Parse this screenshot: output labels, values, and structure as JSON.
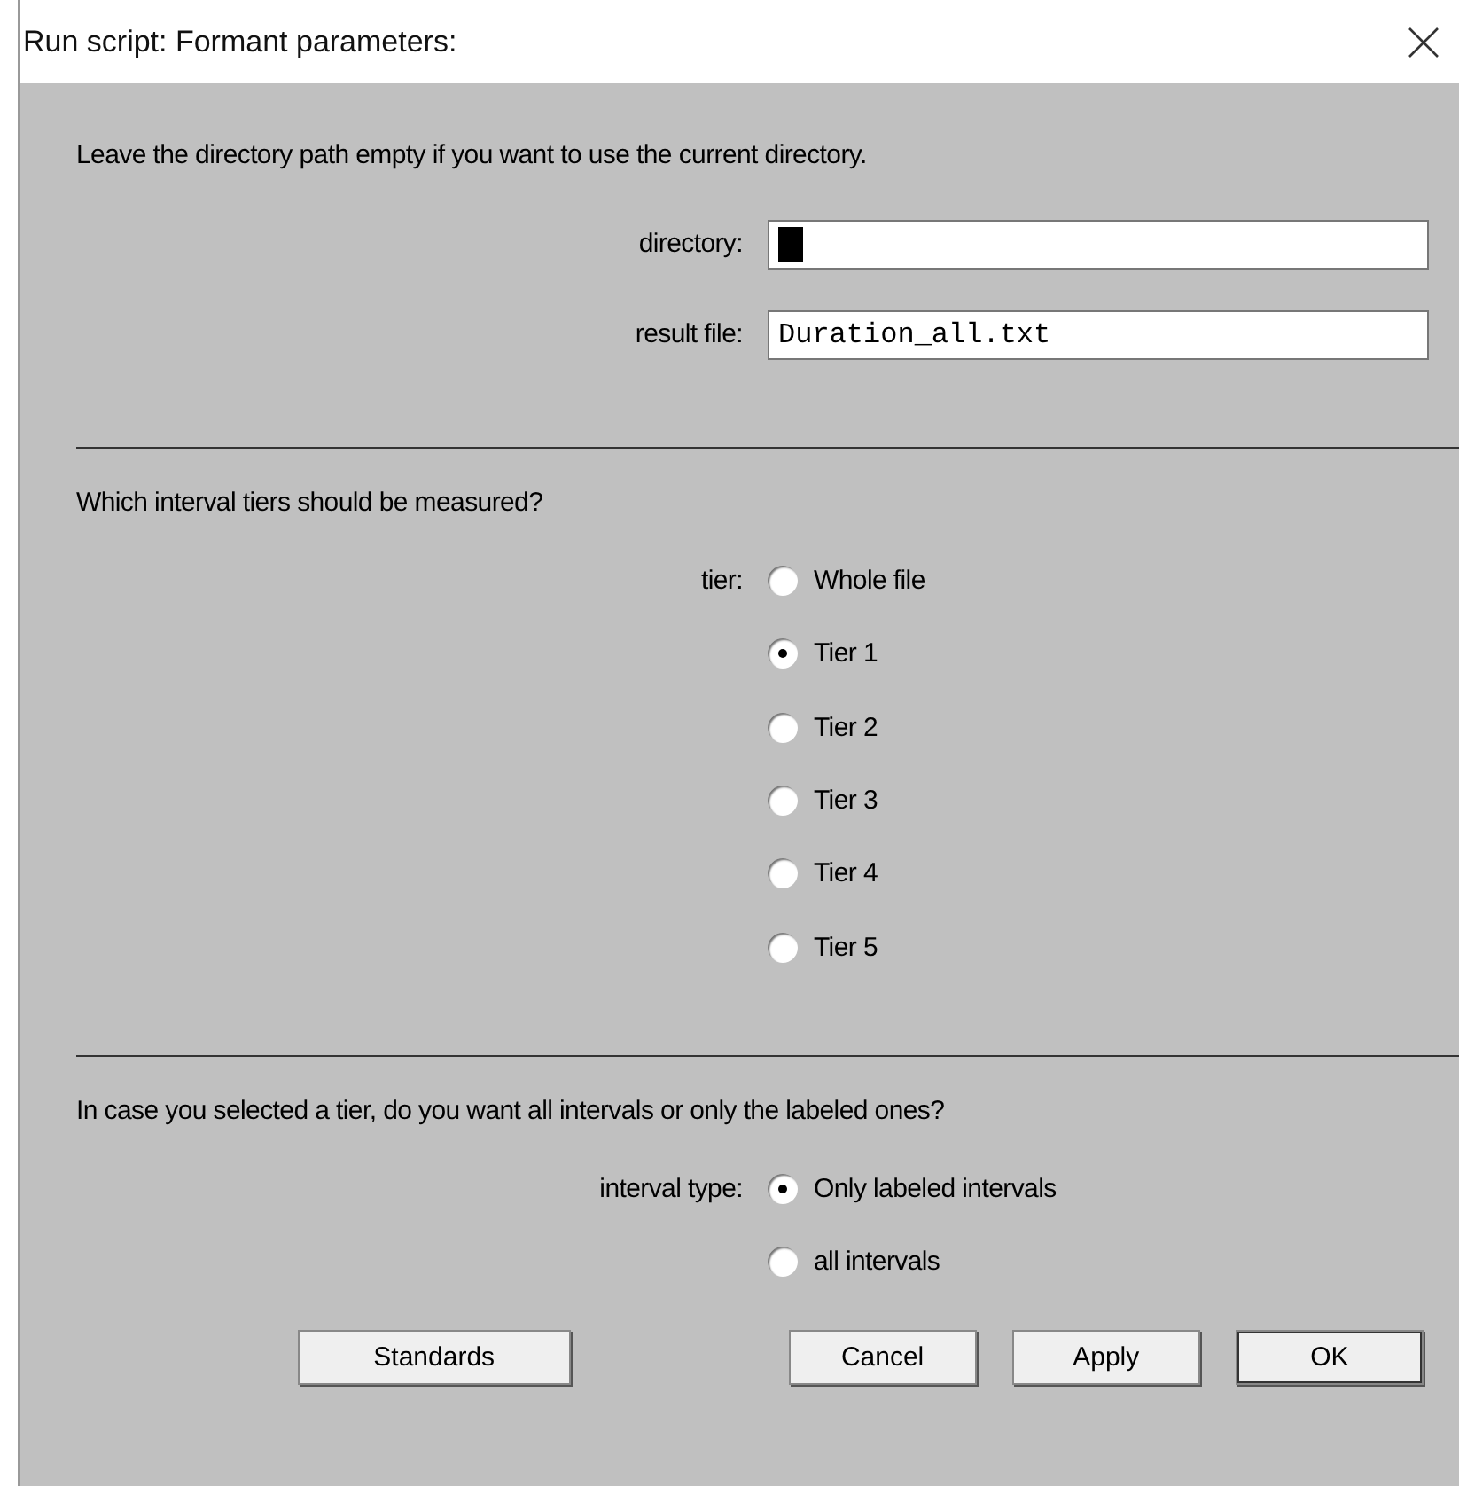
{
  "window": {
    "title": "Run script: Formant parameters:"
  },
  "sections": [
    {
      "kind": "fields",
      "text": "Leave the directory path empty if you want to use the current directory.",
      "fields": [
        {
          "label": "directory:",
          "focused": true
        },
        {
          "label": "result file:",
          "value": "Duration_all.txt",
          "focused": false
        }
      ]
    },
    {
      "kind": "radio",
      "text": "Which interval tiers should be measured?",
      "label": "tier:",
      "options": [
        {
          "label": "Whole file",
          "selected": false
        },
        {
          "label": "Tier 1",
          "selected": true
        },
        {
          "label": "Tier 2",
          "selected": false
        },
        {
          "label": "Tier 3",
          "selected": false
        },
        {
          "label": "Tier 4",
          "selected": false
        },
        {
          "label": "Tier 5",
          "selected": false
        }
      ]
    },
    {
      "kind": "radio",
      "text": "In case you selected a tier, do you want all intervals or only the labeled ones?",
      "label": "interval type:",
      "options": [
        {
          "label": "Only labeled intervals",
          "selected": true
        },
        {
          "label": "all intervals",
          "selected": false
        }
      ]
    }
  ],
  "buttons": [
    {
      "label": "Standards",
      "default": false
    },
    {
      "label": "Cancel",
      "default": false
    },
    {
      "label": "Apply",
      "default": false
    },
    {
      "label": "OK",
      "default": true
    }
  ]
}
